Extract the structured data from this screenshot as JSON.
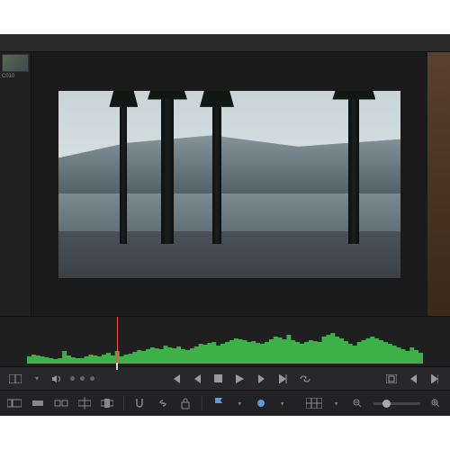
{
  "clip": {
    "label": "C010"
  },
  "transport": {
    "display_mode": "display-mode",
    "volume": "volume",
    "prev_clip": "prev-clip",
    "step_back": "step-back",
    "stop": "stop",
    "play": "play",
    "step_fwd": "step-forward",
    "next_clip": "next-clip",
    "loop": "loop",
    "in_point": "in-point",
    "out_point": "out-point",
    "go_in": "go-to-in",
    "go_out": "go-to-out"
  },
  "toolbar": {
    "selection": "selection-tool",
    "trim": "trim-tool",
    "blade": "blade-tool",
    "insert": "insert-tool",
    "overwrite": "overwrite-tool",
    "snap": "snap",
    "link": "link-clips",
    "lock": "lock",
    "marker_in": "marker-in",
    "marker_out": "marker-out",
    "timeline_view": "timeline-view",
    "zoom_out": "zoom-out",
    "zoom_in": "zoom-in"
  },
  "colors": {
    "waveform": "#3eb048",
    "playhead": "#ff5050",
    "accent": "#5a9ae0"
  },
  "waveform_heights": [
    8,
    10,
    9,
    8,
    7,
    6,
    5,
    6,
    14,
    9,
    7,
    6,
    6,
    8,
    10,
    9,
    8,
    10,
    12,
    9,
    14,
    8,
    10,
    11,
    13,
    15,
    14,
    16,
    18,
    17,
    16,
    20,
    18,
    17,
    19,
    16,
    15,
    17,
    19,
    22,
    21,
    23,
    24,
    20,
    22,
    24,
    26,
    28,
    27,
    26,
    24,
    25,
    23,
    22,
    24,
    27,
    30,
    29,
    27,
    32,
    26,
    24,
    22,
    24,
    26,
    25,
    24,
    30,
    32,
    34,
    30,
    28,
    25,
    22,
    20,
    24,
    26,
    28,
    30,
    28,
    26,
    24,
    22,
    20,
    18,
    16,
    14,
    18,
    15,
    12
  ]
}
